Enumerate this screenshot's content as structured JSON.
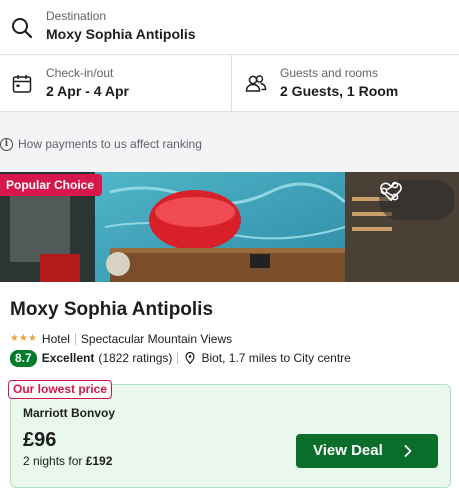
{
  "search": {
    "destination_label": "Destination",
    "destination_value": "Moxy Sophia Antipolis",
    "dates_label": "Check-in/out",
    "dates_value": "2 Apr - 4 Apr",
    "guests_label": "Guests and rooms",
    "guests_value": "2 Guests, 1 Room"
  },
  "disclaimer": {
    "text": "How payments to us affect ranking",
    "icon": "info-icon"
  },
  "hotel": {
    "badge": "Popular Choice",
    "name": "Moxy Sophia Antipolis",
    "stars": 3,
    "type": "Hotel",
    "feature": "Spectacular Mountain Views",
    "score": "8.7",
    "rating_word": "Excellent",
    "rating_count": "(1822 ratings)",
    "location": "Biot, 1.7 miles to City centre"
  },
  "deal": {
    "badge": "Our lowest price",
    "provider": "Marriott Bonvoy",
    "price": "£96",
    "nights_prefix": "2 nights for ",
    "total": "£192",
    "button_label": "View Deal"
  },
  "colors": {
    "accent_red": "#d5174c",
    "deal_green": "#0a6e2a",
    "score_green": "#007d2a",
    "deal_bg": "#e9f7ec",
    "star": "#e8a33d"
  },
  "icons": [
    "search-icon",
    "calendar-icon",
    "guests-icon",
    "info-icon",
    "share-icon",
    "heart-icon",
    "map-pin-icon",
    "chevron-right-icon"
  ]
}
